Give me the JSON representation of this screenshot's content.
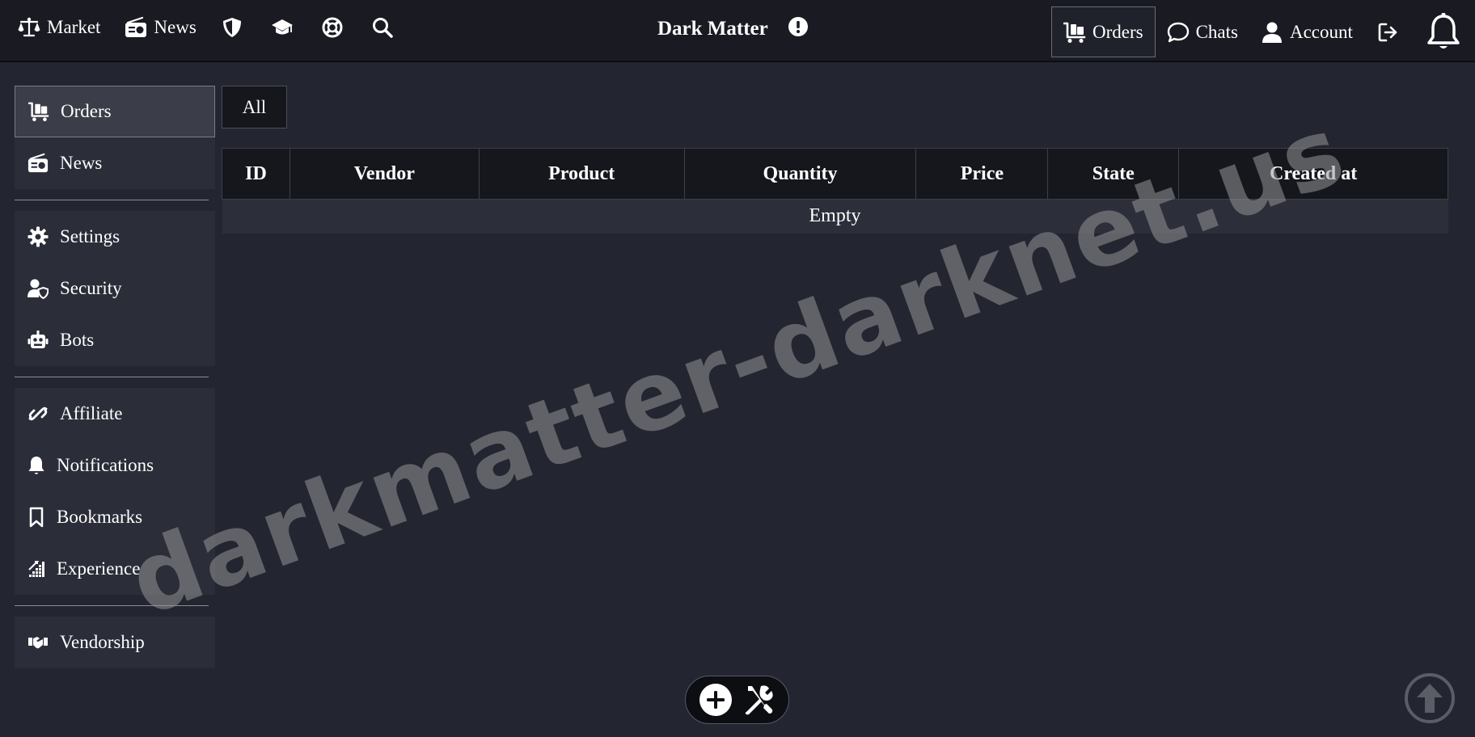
{
  "topbar": {
    "left_items": [
      {
        "label": "Market",
        "icon": "scale-icon"
      },
      {
        "label": "News",
        "icon": "radio-icon"
      }
    ],
    "left_icon_items": [
      "shield-icon",
      "graduation-cap-icon",
      "lifebuoy-icon",
      "search-icon"
    ],
    "brand": "Dark Matter",
    "brand_icon": "exclamation-circle-icon",
    "right_items": [
      {
        "label": "Orders",
        "icon": "cart-flatbed-icon",
        "active": true
      },
      {
        "label": "Chats",
        "icon": "comment-icon"
      },
      {
        "label": "Account",
        "icon": "user-icon"
      }
    ],
    "right_icon_items": [
      "logout-icon",
      "bell-icon"
    ]
  },
  "sidebar": {
    "group1": [
      {
        "label": "Orders",
        "icon": "cart-flatbed-icon",
        "active": true
      },
      {
        "label": "News",
        "icon": "radio-icon"
      }
    ],
    "group2": [
      {
        "label": "Settings",
        "icon": "gear-icon"
      },
      {
        "label": "Security",
        "icon": "user-shield-icon"
      },
      {
        "label": "Bots",
        "icon": "robot-icon"
      }
    ],
    "group3": [
      {
        "label": "Affiliate",
        "icon": "link-icon"
      },
      {
        "label": "Notifications",
        "icon": "bell-icon"
      },
      {
        "label": "Bookmarks",
        "icon": "bookmark-icon"
      },
      {
        "label": "Experience",
        "icon": "chart-icon"
      }
    ],
    "group4": [
      {
        "label": "Vendorship",
        "icon": "handshake-icon"
      }
    ]
  },
  "main": {
    "filter_label": "All",
    "table": {
      "columns": [
        "ID",
        "Vendor",
        "Product",
        "Quantity",
        "Price",
        "State",
        "Created at"
      ],
      "empty_text": "Empty"
    }
  },
  "watermark": "darkmatter-darknet.us",
  "bottom": {
    "fab_icons": [
      "plus-circle-icon",
      "tools-icon"
    ],
    "scroll_top_icon": "arrow-up-circle-icon"
  },
  "colors": {
    "background": "#232530",
    "topbar": "#1a1b22",
    "sidebar_group": "#2b2d38",
    "table_header": "#16171d",
    "table_row": "#2c2e39"
  }
}
